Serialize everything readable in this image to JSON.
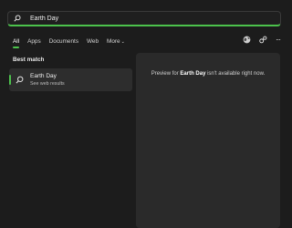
{
  "search": {
    "value": "Earth Day",
    "icon": "search-icon"
  },
  "tabs": [
    {
      "label": "All",
      "active": true
    },
    {
      "label": "Apps"
    },
    {
      "label": "Documents"
    },
    {
      "label": "Web"
    },
    {
      "label": "More"
    }
  ],
  "toolbar": {
    "icons": [
      "globe-icon",
      "share-icon",
      "more-options-icon"
    ],
    "more_label": "···"
  },
  "best_match": {
    "heading": "Best match",
    "item": {
      "title": "Earth Day",
      "subtitle": "See web results",
      "icon": "search-icon"
    }
  },
  "preview": {
    "prefix": "Preview for ",
    "query": "Earth Day",
    "suffix": " isn't available right now."
  },
  "colors": {
    "accent": "#4cc24c",
    "background": "#1c1c1c",
    "panel": "#2a2a2a"
  }
}
